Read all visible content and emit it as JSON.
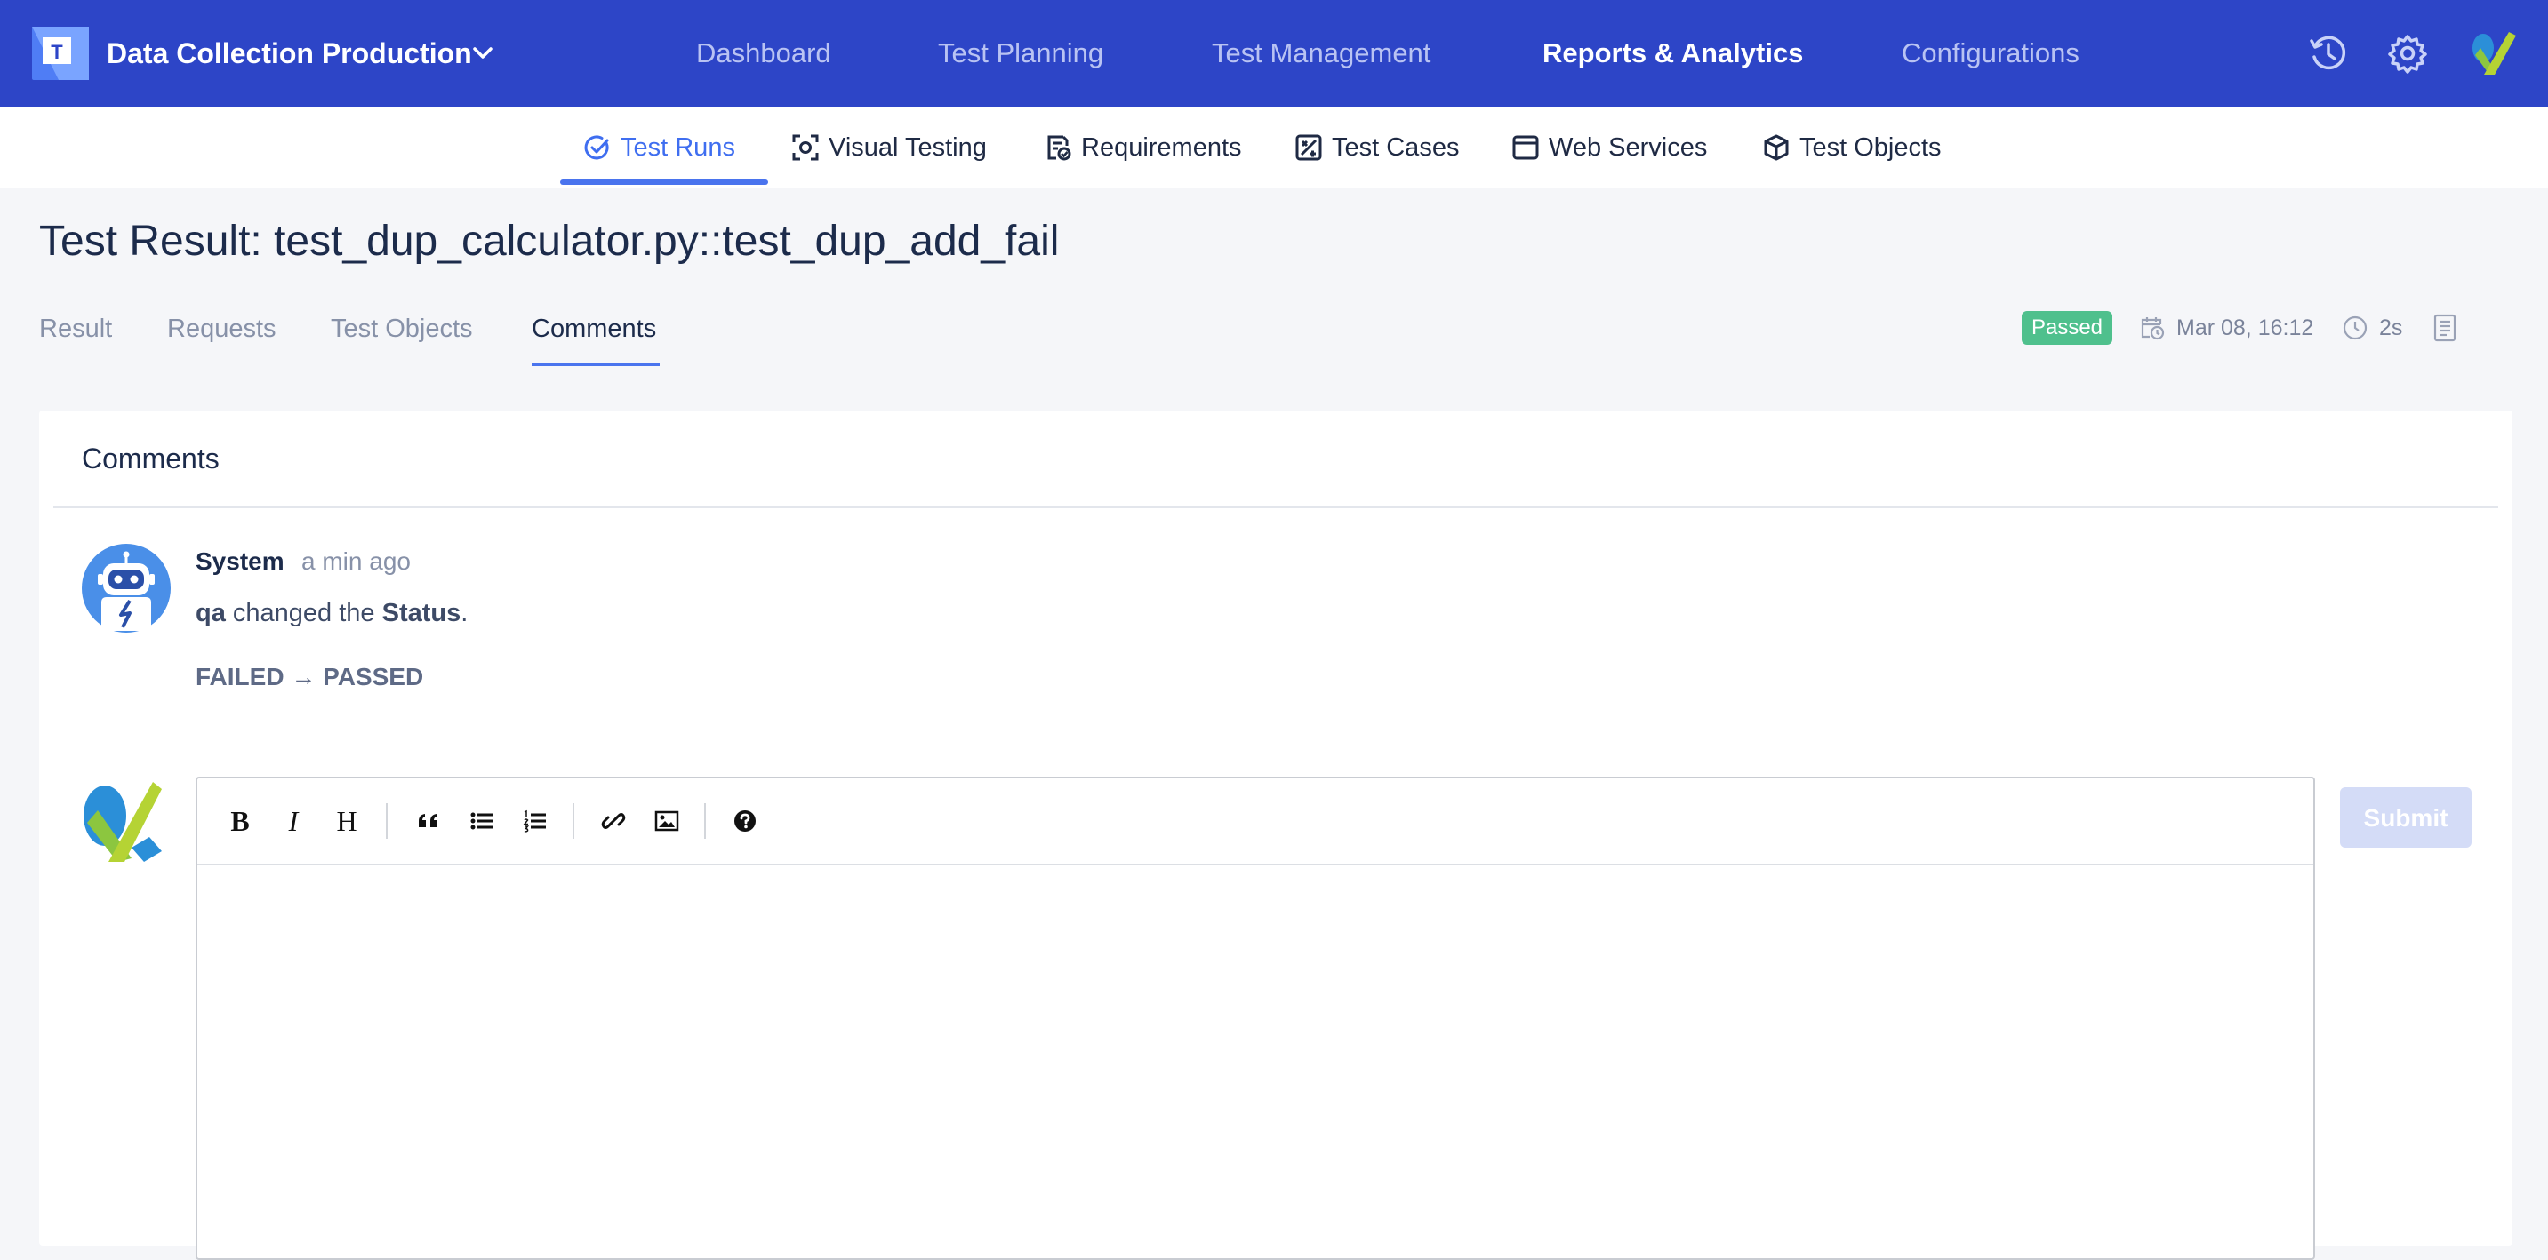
{
  "header": {
    "project_name": "Data Collection Production",
    "nav": [
      "Dashboard",
      "Test Planning",
      "Test Management",
      "Reports & Analytics",
      "Configurations"
    ],
    "active_nav": "Reports & Analytics"
  },
  "subnav": {
    "items": [
      "Test Runs",
      "Visual Testing",
      "Requirements",
      "Test Cases",
      "Web Services",
      "Test Objects"
    ],
    "active": "Test Runs"
  },
  "page": {
    "title": "Test Result: test_dup_calculator.py::test_dup_add_fail",
    "tabs": [
      "Result",
      "Requests",
      "Test Objects",
      "Comments"
    ],
    "active_tab": "Comments",
    "status": "Passed",
    "date": "Mar 08, 16:12",
    "duration": "2s"
  },
  "comments": {
    "title": "Comments",
    "items": [
      {
        "author": "System",
        "time": "a min ago",
        "user": "qa",
        "text_mid": " changed the ",
        "field": "Status",
        "text_end": ".",
        "change": "FAILED → PASSED"
      }
    ]
  },
  "editor": {
    "toolbar": [
      "bold",
      "italic",
      "heading",
      "quote",
      "unordered-list",
      "ordered-list",
      "link",
      "image",
      "help"
    ],
    "bold_label": "B",
    "italic_label": "I",
    "heading_label": "H",
    "submit_label": "Submit"
  },
  "colors": {
    "header_bg": "#2d45c7",
    "accent": "#4a74ee",
    "status_passed": "#4fc08d",
    "submit_disabled": "#d4dcf7"
  }
}
